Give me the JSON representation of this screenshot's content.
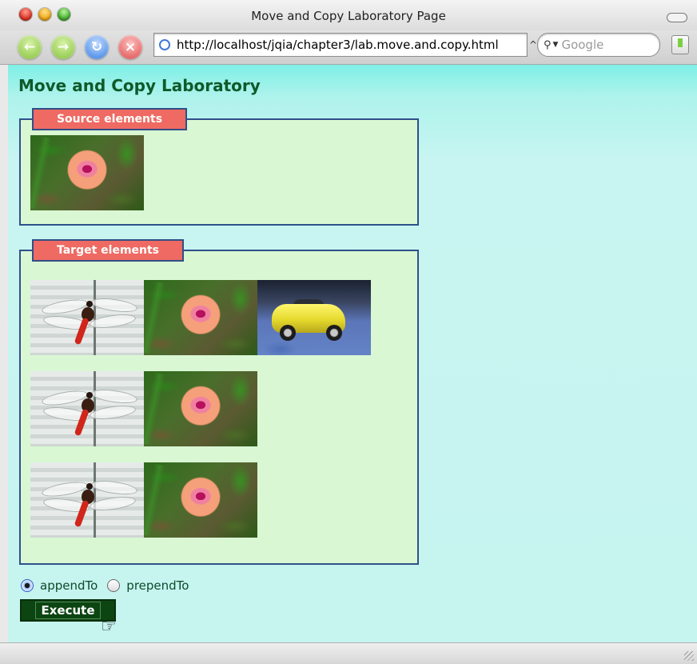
{
  "window": {
    "title": "Move and Copy Laboratory Page"
  },
  "toolbar": {
    "url": "http://localhost/jqia/chapter3/lab.move.and.copy.html",
    "search_placeholder": "Google"
  },
  "page": {
    "title": "Move and Copy Laboratory",
    "source": {
      "legend": "Source elements",
      "images": [
        "flower"
      ]
    },
    "target": {
      "legend": "Target elements",
      "rows": [
        [
          "dragonfly",
          "flower",
          "car"
        ],
        [
          "dragonfly",
          "flower"
        ],
        [
          "dragonfly",
          "flower"
        ]
      ]
    },
    "options": [
      {
        "label": "appendTo",
        "checked": true
      },
      {
        "label": "prependTo",
        "checked": false
      }
    ],
    "execute_label": "Execute"
  },
  "icons": [
    "close-button-icon",
    "minimize-button-icon",
    "zoom-button-icon",
    "back-icon",
    "forward-icon",
    "reload-icon",
    "stop-icon",
    "globe-icon",
    "search-icon",
    "bookmark-icon",
    "hand-cursor-icon",
    "resize-grip-icon"
  ]
}
